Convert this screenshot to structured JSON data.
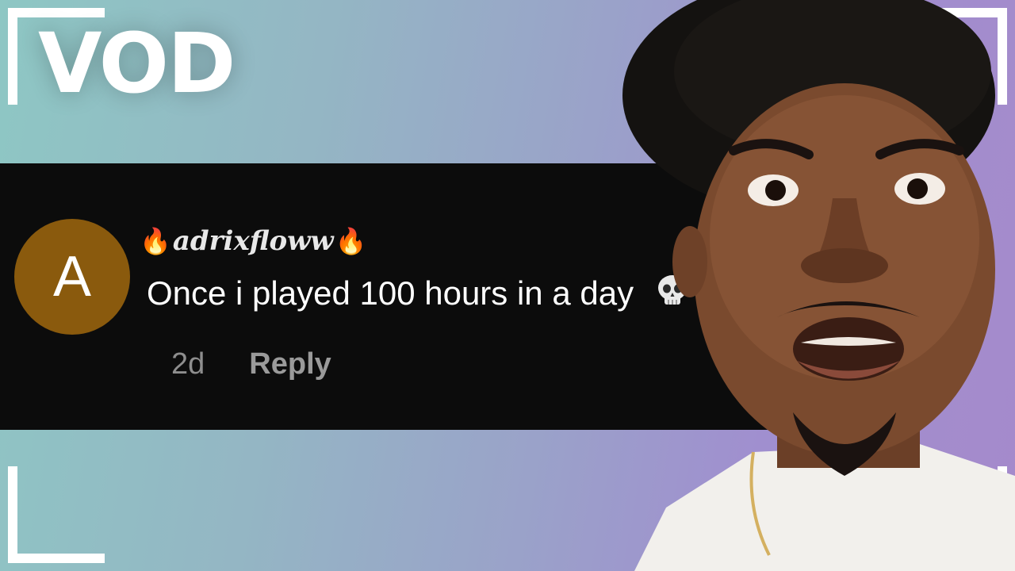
{
  "thumbnail": {
    "label": "VOD"
  },
  "comment": {
    "avatar_letter": "A",
    "avatar_color": "#8a5a0d",
    "username": "adrixfloww",
    "username_prefix_emoji": "🔥",
    "username_suffix_emoji": "🔥",
    "text": "Once i played 100 hours in a day",
    "trailing_emoji_icon": "skull-icon",
    "age": "2d",
    "reply_label": "Reply"
  },
  "colors": {
    "background_left": "#8ec7c4",
    "background_right": "#a58acb",
    "card": "#0c0c0c",
    "frame": "#ffffff"
  }
}
